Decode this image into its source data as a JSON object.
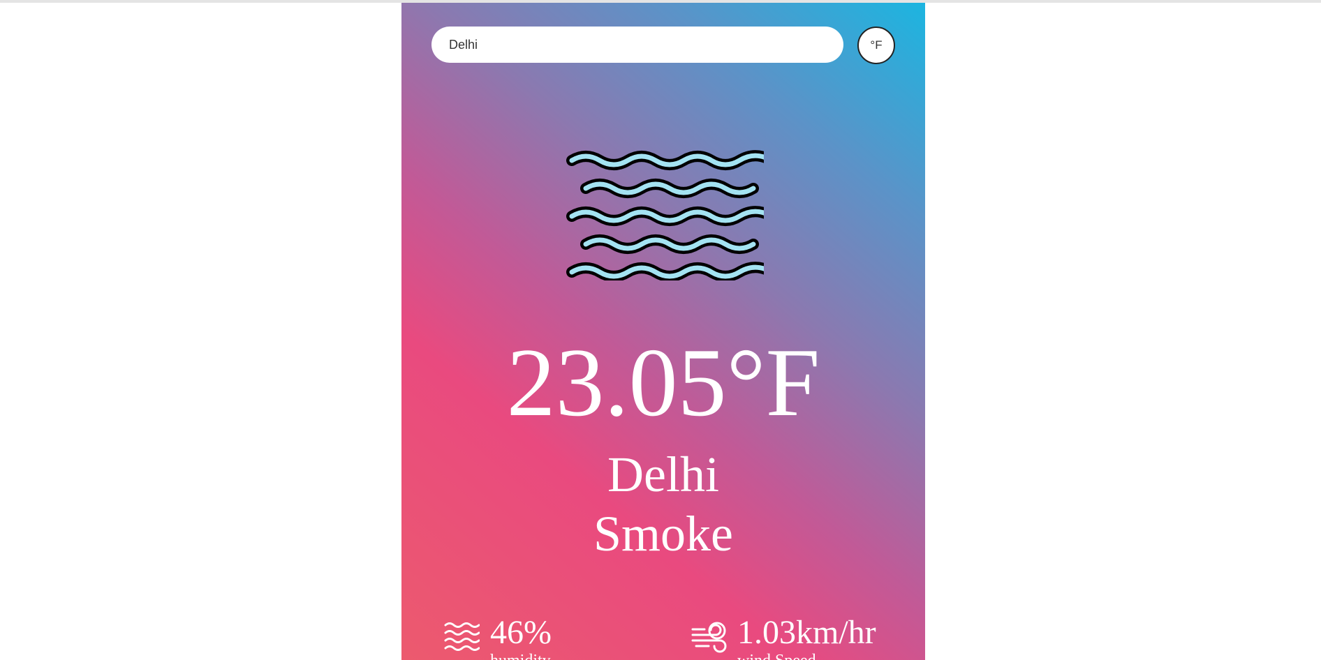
{
  "search": {
    "value": "Delhi",
    "placeholder": ""
  },
  "unit_toggle": {
    "label": "°F"
  },
  "weather": {
    "icon": "mist-icon",
    "temperature": "23.05°F",
    "city": "Delhi",
    "condition": "Smoke"
  },
  "stats": {
    "humidity": {
      "icon": "humidity-waves-icon",
      "value": "46%",
      "label": "humidity"
    },
    "wind": {
      "icon": "wind-icon",
      "value": "1.03km/hr",
      "label": "wind Speed"
    }
  },
  "colors": {
    "gradient_top_right": "#1cb5e0",
    "gradient_bottom_left": "#e94a7f",
    "text": "#ffffff",
    "icon_wave_fill": "#a4e3f2",
    "icon_wave_outline": "#000000"
  }
}
